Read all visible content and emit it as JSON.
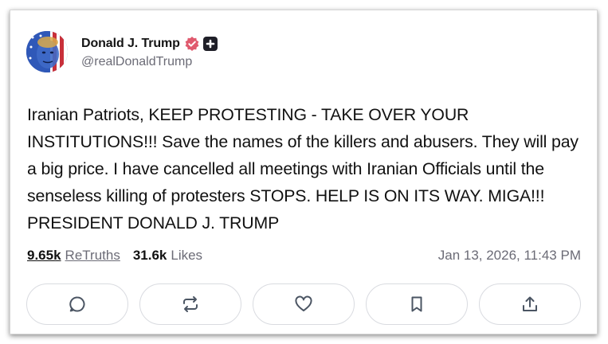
{
  "post": {
    "author": {
      "display_name": "Donald J. Trump",
      "handle": "@realDonaldTrump"
    },
    "text": "Iranian Patriots, KEEP PROTESTING - TAKE OVER YOUR INSTITUTIONS!!! Save the names of the killers and abusers. They will pay a big price. I have cancelled all meetings with Iranian Officials until the senseless killing of protesters STOPS. HELP IS ON ITS WAY. MIGA!!! PRESIDENT DONALD J. TRUMP",
    "stats": {
      "retruths_count": "9.65k",
      "retruths_label": "ReTruths",
      "likes_count": "31.6k",
      "likes_label": "Likes"
    },
    "timestamp": "Jan 13, 2026, 11:43 PM"
  },
  "icons": {
    "verified": "verified-badge-icon",
    "plus": "plus-badge-icon",
    "reply": "reply-icon",
    "retruth": "retruth-icon",
    "like": "heart-icon",
    "bookmark": "bookmark-icon",
    "share": "share-icon"
  },
  "colors": {
    "verified_badge": "#e05a6e",
    "text_primary": "#111111",
    "text_secondary": "#6b6b76",
    "action_border": "#d9dbe0"
  }
}
